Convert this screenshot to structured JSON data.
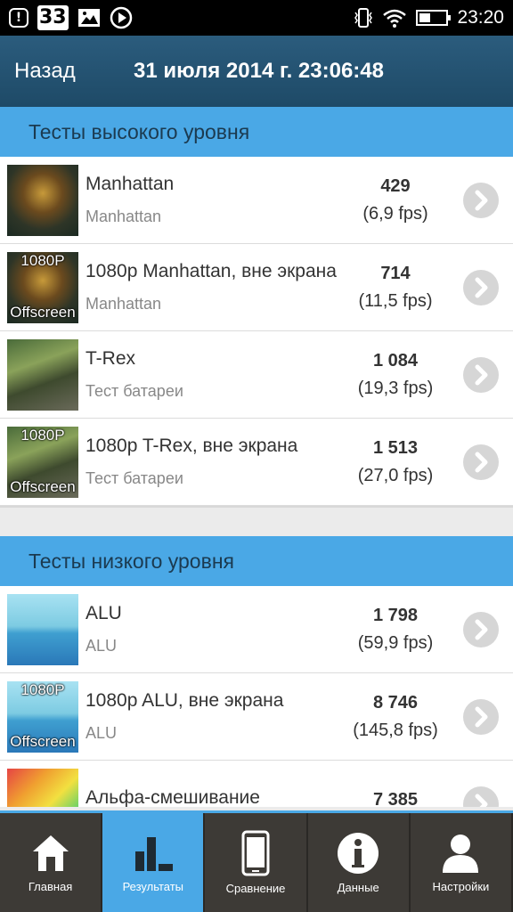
{
  "status_bar": {
    "notification_badge": "!",
    "notification_count": "33",
    "time": "23:20",
    "battery_level": 0.35
  },
  "header": {
    "back_label": "Назад",
    "date": "31 июля 2014 г. 23:06:48"
  },
  "sections": {
    "high": {
      "title": "Тесты высокого уровня",
      "rows": [
        {
          "title": "Manhattan",
          "subtitle": "Manhattan",
          "score": "429",
          "fps": "(6,9 fps)",
          "thumb": "manhattan"
        },
        {
          "title": "1080p Manhattan, вне экрана",
          "subtitle": "Manhattan",
          "score": "714",
          "fps": "(11,5 fps)",
          "thumb": "manhattan",
          "tag_top": "1080P",
          "tag_bottom": "Offscreen"
        },
        {
          "title": "T-Rex",
          "subtitle": "Тест батареи",
          "score": "1 084",
          "fps": "(19,3 fps)",
          "thumb": "trex"
        },
        {
          "title": "1080p T-Rex, вне экрана",
          "subtitle": "Тест батареи",
          "score": "1 513",
          "fps": "(27,0 fps)",
          "thumb": "trex",
          "tag_top": "1080P",
          "tag_bottom": "Offscreen"
        }
      ]
    },
    "low": {
      "title": "Тесты низкого уровня",
      "rows": [
        {
          "title": "ALU",
          "subtitle": "ALU",
          "score": "1 798",
          "fps": "(59,9 fps)",
          "thumb": "alu"
        },
        {
          "title": "1080p ALU, вне экрана",
          "subtitle": "ALU",
          "score": "8 746",
          "fps": "(145,8 fps)",
          "thumb": "alu",
          "tag_top": "1080P",
          "tag_bottom": "Offscreen"
        },
        {
          "title": "Альфа-смешивание",
          "subtitle": "",
          "score": "7 385",
          "fps": "",
          "thumb": "alpha"
        }
      ]
    }
  },
  "nav": {
    "home": "Главная",
    "results": "Результаты",
    "compare": "Сравнение",
    "data": "Данные",
    "settings": "Настройки"
  }
}
